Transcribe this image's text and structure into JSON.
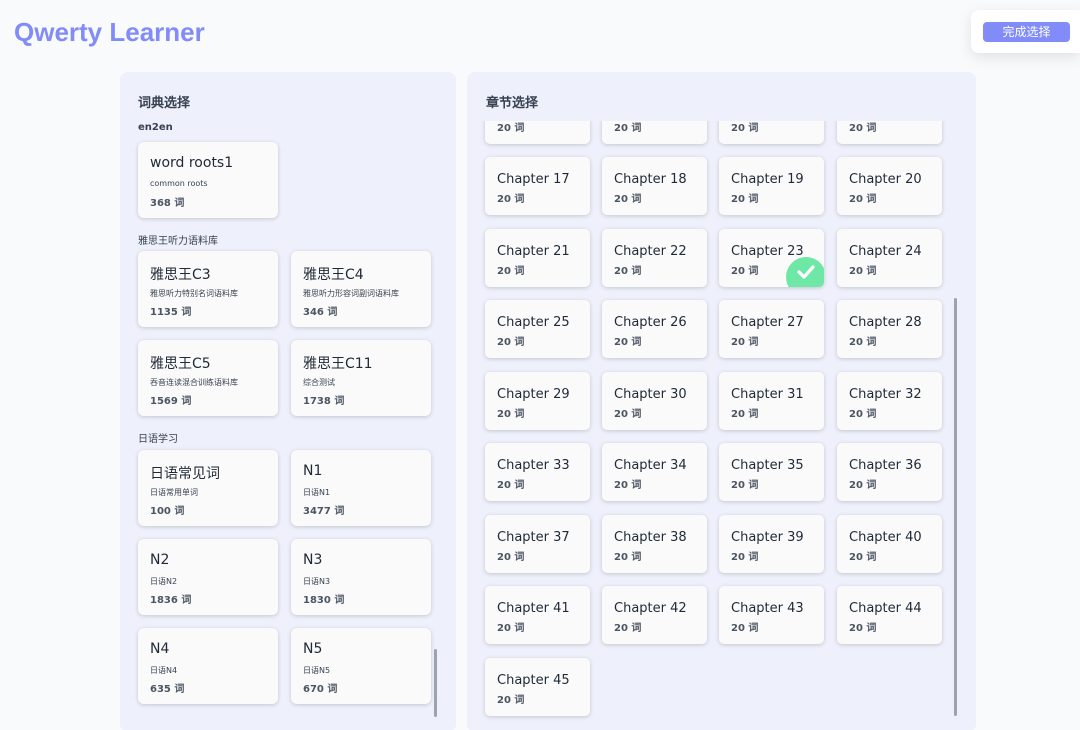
{
  "app": {
    "title": "Qwerty Learner"
  },
  "header": {
    "finish_label": "完成选择"
  },
  "dict_panel": {
    "title": "词典选择",
    "groups": [
      {
        "label": "en2en",
        "items": [
          {
            "name": "word roots1",
            "desc": "common roots",
            "count": "368 词"
          }
        ]
      },
      {
        "label": "雅思王听力语料库",
        "items": [
          {
            "name": "雅思王C3",
            "desc": "雅思听力特别名词语料库",
            "count": "1135 词"
          },
          {
            "name": "雅思王C4",
            "desc": "雅思听力形容词副词语料库",
            "count": "346 词"
          },
          {
            "name": "雅思王C5",
            "desc": "吞音连读混合训练语料库",
            "count": "1569 词"
          },
          {
            "name": "雅思王C11",
            "desc": "综合测试",
            "count": "1738 词"
          }
        ]
      },
      {
        "label": "日语学习",
        "items": [
          {
            "name": "日语常见词",
            "desc": "日语常用单词",
            "count": "100 词"
          },
          {
            "name": "N1",
            "desc": "日语N1",
            "count": "3477 词"
          },
          {
            "name": "N2",
            "desc": "日语N2",
            "count": "1836 词"
          },
          {
            "name": "N3",
            "desc": "日语N3",
            "count": "1830 词"
          },
          {
            "name": "N4",
            "desc": "日语N4",
            "count": "635 词"
          },
          {
            "name": "N5",
            "desc": "日语N5",
            "count": "670 词"
          }
        ]
      }
    ]
  },
  "chapter_panel": {
    "title": "章节选择",
    "selected": "Chapter 23",
    "count_label": "20 词",
    "partial_top_count": [
      "20 词",
      "20 词",
      "20 词",
      "20 词"
    ],
    "chapters": [
      "Chapter 17",
      "Chapter 18",
      "Chapter 19",
      "Chapter 20",
      "Chapter 21",
      "Chapter 22",
      "Chapter 23",
      "Chapter 24",
      "Chapter 25",
      "Chapter 26",
      "Chapter 27",
      "Chapter 28",
      "Chapter 29",
      "Chapter 30",
      "Chapter 31",
      "Chapter 32",
      "Chapter 33",
      "Chapter 34",
      "Chapter 35",
      "Chapter 36",
      "Chapter 37",
      "Chapter 38",
      "Chapter 39",
      "Chapter 40",
      "Chapter 41",
      "Chapter 42",
      "Chapter 43",
      "Chapter 44",
      "Chapter 45"
    ]
  },
  "colors": {
    "brand": "#818cf8",
    "panel_bg": "#eef0fb",
    "check": "#6ee7a7"
  }
}
